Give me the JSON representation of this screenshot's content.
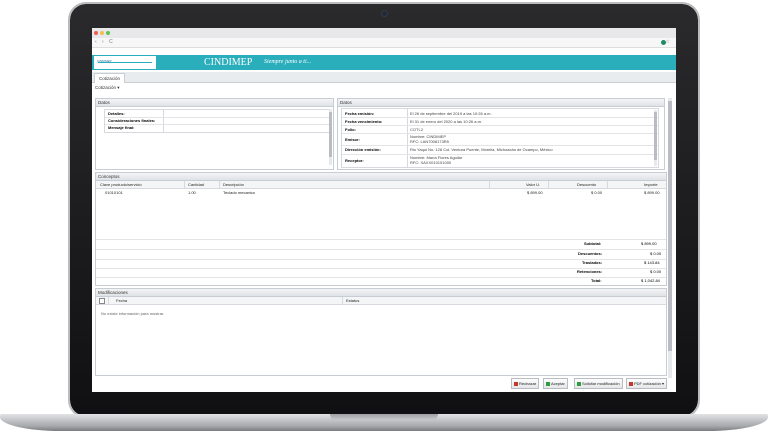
{
  "browser": {
    "nav_glyphs": "‹ › C",
    "right_glyph": "☆"
  },
  "banner": {
    "logo_text": "CINDIMEP",
    "brand": "CINDIMEP",
    "slogan": "Siempre junto a ti..."
  },
  "tabs": [
    {
      "label": "Cotización"
    }
  ],
  "menu": {
    "label": "Cotización ▾"
  },
  "datos_left": {
    "title": "Datos",
    "fields": [
      {
        "label": "Detalles:",
        "value": ""
      },
      {
        "label": "Consideraciones finales:",
        "value": ""
      },
      {
        "label": "Mensaje final:",
        "value": ""
      }
    ]
  },
  "datos_right": {
    "title": "Datos",
    "fields": [
      {
        "label": "Fecha emisión:",
        "value": "El 26 de septiembre del 2019 a las 10:26 a.m."
      },
      {
        "label": "Fecha vencimiento:",
        "value": "El 31 de enero del 2020 a las 10:26 a.m."
      },
      {
        "label": "Folio:",
        "value": "COTI-2"
      },
      {
        "label": "Emisor:",
        "value": "Nombre: CINDIMEP",
        "value2": "RFC: LAN7008173R5"
      },
      {
        "label": "Dirección emisión:",
        "value": "Rio Yaqui No. 128 Col. Ventura Puente, Morelia, Michoacán de Ocampo, México"
      },
      {
        "label": "Receptor:",
        "value": "Nombre: María Flores Aguilar",
        "value2": "RFC: XAXX010101000"
      }
    ]
  },
  "conceptos": {
    "title": "Conceptos",
    "headers": {
      "clave": "Clave producto/servicio",
      "cantidad": "Cantidad",
      "descripcion": "Descripción",
      "valor": "Valor U.",
      "descuento": "Descuento",
      "importe": "Importe"
    },
    "rows": [
      {
        "clave": "01010101",
        "cantidad": "1.00",
        "descripcion": "Teclado mecanico",
        "valor": "$ 899.00",
        "descuento": "$ 0.00",
        "importe": "$ 899.00"
      }
    ],
    "totals": [
      {
        "label": "Subtotal:",
        "value": "$ 899.00"
      },
      {
        "label": "Descuentos:",
        "value": "$ 0.00"
      },
      {
        "label": "Traslados:",
        "value": "$ 143.84"
      },
      {
        "label": "Retenciones:",
        "value": "$ 0.00"
      },
      {
        "label": "Total:",
        "value": "$ 1,042.84"
      }
    ]
  },
  "modificaciones": {
    "title": "Modificaciones",
    "headers": {
      "fecha": "Fecha",
      "estatus": "Estatus"
    },
    "empty": "No existe información para mostrar."
  },
  "actions": {
    "rechazar": "Rechazar",
    "aceptar": "Aceptar",
    "solicitar": "Solicitar modificación",
    "pdf": "PDF cotización ▾"
  },
  "colors": {
    "banner": "#2aaebc",
    "reject": "#c0392b",
    "accept": "#2e9d3f",
    "pdf": "#c0392b"
  }
}
